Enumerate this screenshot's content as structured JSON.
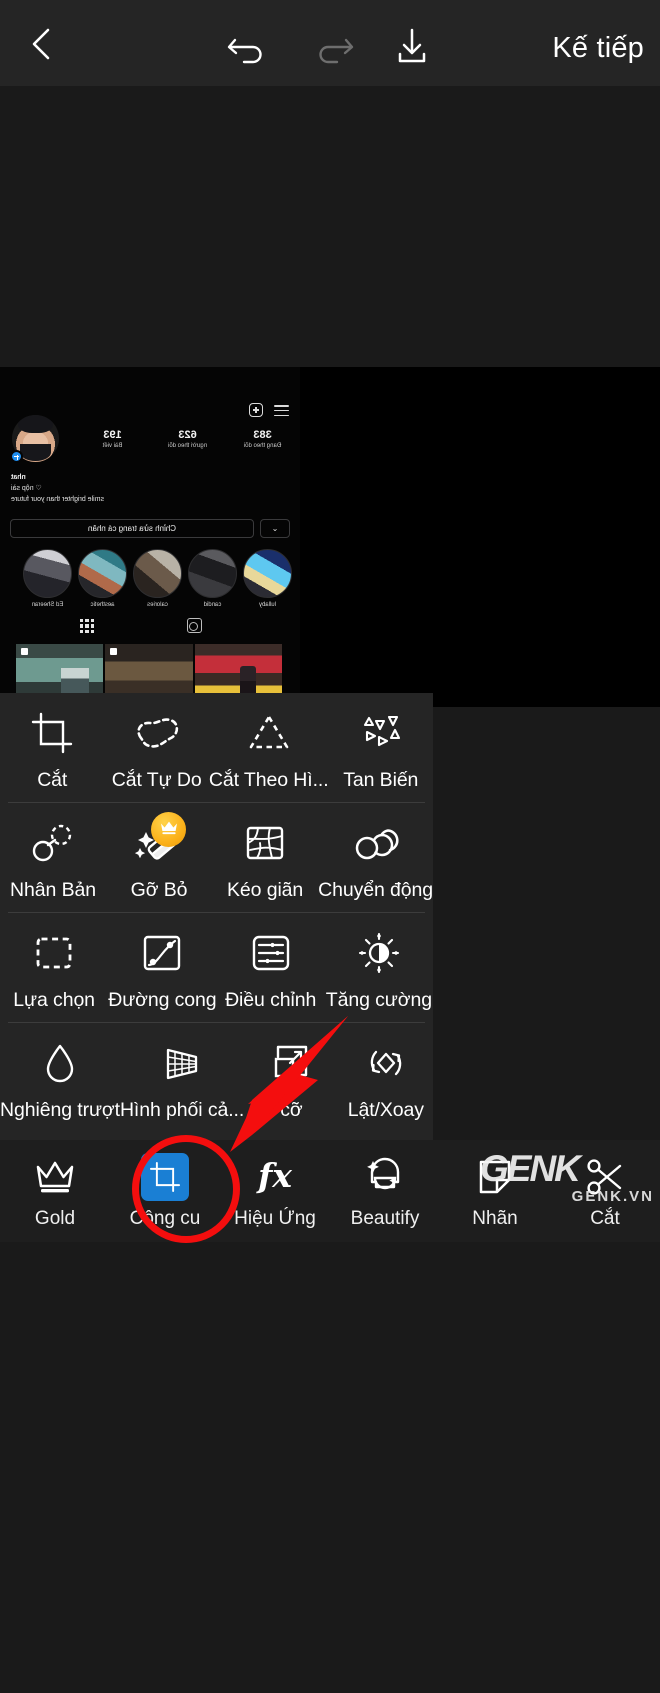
{
  "topbar": {
    "back_icon": "chevron-left-icon",
    "undo_icon": "undo-icon",
    "redo_icon": "redo-icon",
    "save_icon": "download-icon",
    "next_label": "Kế tiếp"
  },
  "canvas": {
    "background_color": "#1a1a1a",
    "photo_background": "#000000",
    "preview": {
      "description": "mirrored instagram profile screenshot",
      "stats": [
        {
          "number": "383",
          "label": "Đang theo dõi"
        },
        {
          "number": "623",
          "label": "người theo dõi"
        },
        {
          "number": "193",
          "label": "Bài viết"
        }
      ],
      "profile_name": "nhat",
      "bio_line2": "♡ nộp sài",
      "bio_line3": "smile brighter than your future",
      "edit_button": "Chỉnh sửa trang cá nhân",
      "highlights": [
        "lullaby",
        "candid",
        "calories",
        "aesthetic",
        "Ed Sheeran"
      ]
    }
  },
  "toolpanel": {
    "background_color": "#252525",
    "rows": [
      [
        {
          "label": "Cắt",
          "icon": "crop-icon",
          "pro": false
        },
        {
          "label": "Cắt Tự Do",
          "icon": "freeform-cut-icon",
          "pro": false
        },
        {
          "label": "Cắt Theo Hì...",
          "icon": "shape-cut-icon",
          "pro": false
        },
        {
          "label": "Tan Biến",
          "icon": "dispersion-icon",
          "pro": false
        }
      ],
      [
        {
          "label": "Nhân Bản",
          "icon": "clone-icon",
          "pro": false
        },
        {
          "label": "Gỡ Bỏ",
          "icon": "remove-eraser-icon",
          "pro": true
        },
        {
          "label": "Kéo giãn",
          "icon": "stretch-mesh-icon",
          "pro": false
        },
        {
          "label": "Chuyển động",
          "icon": "motion-icon",
          "pro": false
        }
      ],
      [
        {
          "label": "Lựa chọn",
          "icon": "selection-icon",
          "pro": false
        },
        {
          "label": "Đường cong",
          "icon": "curves-icon",
          "pro": false
        },
        {
          "label": "Điều chỉnh",
          "icon": "adjust-sliders-icon",
          "pro": false
        },
        {
          "label": "Tăng cường",
          "icon": "enhance-brightness-icon",
          "pro": false
        }
      ],
      [
        {
          "label": "Nghiêng trượt",
          "icon": "tilt-shift-drop-icon",
          "pro": false
        },
        {
          "label": "Hình phối cả...",
          "icon": "perspective-grid-icon",
          "pro": false
        },
        {
          "label": "cỡ",
          "icon": "resize-icon",
          "pro": false
        },
        {
          "label": "Lật/Xoay",
          "icon": "flip-rotate-icon",
          "pro": false
        }
      ]
    ],
    "pro_badge_icon": "crown-icon",
    "pro_badge_color": "#fbb018"
  },
  "bottomnav": {
    "background_color": "#1e1e1e",
    "selected_color": "#1a7fd4",
    "items": [
      {
        "label": "Gold",
        "icon": "crown-icon",
        "selected": false
      },
      {
        "label": "Công cu",
        "icon": "crop-icon",
        "selected": true
      },
      {
        "label": "Hiệu Ứng",
        "icon": "fx-icon",
        "selected": false
      },
      {
        "label": "Beautify",
        "icon": "face-sparkle-icon",
        "selected": false
      },
      {
        "label": "Nhãn",
        "icon": "sticker-label-icon",
        "selected": false
      },
      {
        "label": "Cắt",
        "icon": "scissors-icon",
        "selected": false
      }
    ]
  },
  "annotations": {
    "circle_color": "#f40e0e",
    "arrow_color": "#f40e0e",
    "circle_target": "Công cu",
    "arrow_target": "Công cu"
  },
  "watermark": {
    "logo_text": "GENK",
    "site_text": "GENK.VN"
  }
}
